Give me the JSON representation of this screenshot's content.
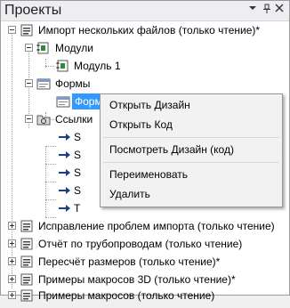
{
  "panel": {
    "title": "Проекты",
    "dropdown_glyph": "▾",
    "pin_glyph": "📌",
    "close_glyph": "✕"
  },
  "tree": {
    "items": [
      {
        "label": "Импорт нескольких файлов (только чтение)*",
        "icon": "project-icon"
      },
      {
        "label": "Модули",
        "icon": "modules-folder-icon"
      },
      {
        "label": "Модуль 1",
        "icon": "module-icon"
      },
      {
        "label": "Формы",
        "icon": "forms-folder-icon"
      },
      {
        "label": "Форма (Модальное окно)",
        "icon": "form-icon",
        "selected": true
      },
      {
        "label": "Ссылки",
        "icon": "references-folder-icon"
      },
      {
        "label": "S",
        "icon": "reference-arrow-icon"
      },
      {
        "label": "S",
        "icon": "reference-arrow-icon"
      },
      {
        "label": "S",
        "icon": "reference-arrow-icon"
      },
      {
        "label": "S",
        "icon": "reference-arrow-icon"
      },
      {
        "label": "T",
        "icon": "reference-arrow-icon"
      },
      {
        "label": "Исправление проблем импорта (только чтение)",
        "icon": "project-icon"
      },
      {
        "label": "Отчёт по трубопроводам (только чтение)",
        "icon": "project-icon"
      },
      {
        "label": "Пересчёт размеров (только чтение)*",
        "icon": "project-icon"
      },
      {
        "label": "Примеры макросов 3D (только чтение)*",
        "icon": "project-icon"
      },
      {
        "label": "Примеры макросов (только чтение)",
        "icon": "project-icon"
      }
    ]
  },
  "context_menu": {
    "items": [
      {
        "label": "Открыть Дизайн"
      },
      {
        "label": "Открыть Код"
      },
      {
        "label": "Посмотреть Дизайн (код)"
      },
      {
        "label": "Переименовать"
      },
      {
        "label": "Удалить"
      }
    ]
  },
  "colors": {
    "selection": "#3399ff",
    "arrow_blue": "#1f3c88",
    "module_green": "#2e8b3a"
  }
}
